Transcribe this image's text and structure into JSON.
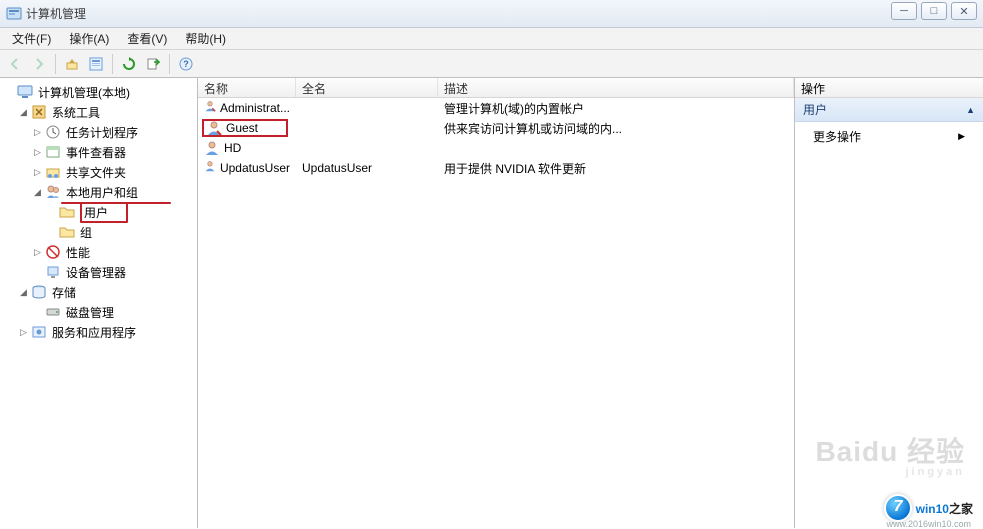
{
  "window": {
    "title": "计算机管理"
  },
  "menu": {
    "file": "文件(F)",
    "action": "操作(A)",
    "view": "查看(V)",
    "help": "帮助(H)"
  },
  "tree": {
    "root": "计算机管理(本地)",
    "system_tools": "系统工具",
    "task_scheduler": "任务计划程序",
    "event_viewer": "事件查看器",
    "shared_folders": "共享文件夹",
    "local_users": "本地用户和组",
    "users": "用户",
    "groups": "组",
    "performance": "性能",
    "device_manager": "设备管理器",
    "storage": "存储",
    "disk_management": "磁盘管理",
    "services_apps": "服务和应用程序"
  },
  "columns": {
    "name": "名称",
    "fullname": "全名",
    "description": "描述"
  },
  "users_list": [
    {
      "name": "Administrat...",
      "fullname": "",
      "description": "管理计算机(域)的内置帐户"
    },
    {
      "name": "Guest",
      "fullname": "",
      "description": "供来宾访问计算机或访问域的内..."
    },
    {
      "name": "HD",
      "fullname": "",
      "description": ""
    },
    {
      "name": "UpdatusUser",
      "fullname": "UpdatusUser",
      "description": "用于提供 NVIDIA 软件更新"
    }
  ],
  "actions": {
    "header": "操作",
    "title": "用户",
    "more": "更多操作"
  },
  "watermark": {
    "brand": "Baidu 经验",
    "sub": "jingyan"
  },
  "corner": {
    "win": "win10",
    "suffix": "之家",
    "url": "www.2016win10.com"
  }
}
